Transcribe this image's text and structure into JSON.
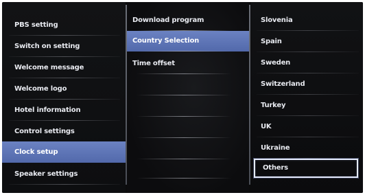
{
  "menu_level1": {
    "items": [
      {
        "label": "PBS setting"
      },
      {
        "label": "Switch on setting"
      },
      {
        "label": "Welcome message"
      },
      {
        "label": "Welcome logo"
      },
      {
        "label": "Hotel information"
      },
      {
        "label": "Control settings"
      },
      {
        "label": "Clock setup",
        "selected": true
      },
      {
        "label": "Speaker settings"
      }
    ]
  },
  "menu_level2": {
    "items": [
      {
        "label": "Download program"
      },
      {
        "label": "Country Selection",
        "selected": true
      },
      {
        "label": "Time offset"
      }
    ]
  },
  "menu_level3": {
    "items": [
      {
        "label": "Slovenia"
      },
      {
        "label": "Spain"
      },
      {
        "label": "Sweden"
      },
      {
        "label": "Switzerland"
      },
      {
        "label": "Turkey"
      },
      {
        "label": "UK"
      },
      {
        "label": "Ukraine"
      },
      {
        "label": "Others",
        "focused": true
      }
    ]
  },
  "colors": {
    "highlight": "#5a72b5",
    "background": "#0b0b0c",
    "text": "#e8eaf0",
    "focus_border": "#e6ecff"
  }
}
